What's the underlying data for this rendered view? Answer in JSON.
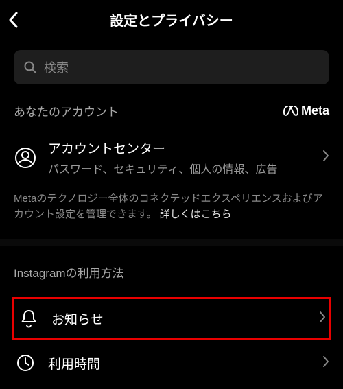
{
  "header": {
    "title": "設定とプライバシー"
  },
  "search": {
    "placeholder": "検索"
  },
  "account": {
    "section_label": "あなたのアカウント",
    "meta_label": "Meta",
    "center_title": "アカウントセンター",
    "center_sub": "パスワード、セキュリティ、個人の情報、広告",
    "note_prefix": "Metaのテクノロジー全体のコネクテッドエクスペリエンスおよびアカウント設定を管理できます。 ",
    "note_link": "詳しくはこちら"
  },
  "usage": {
    "section_label": "Instagramの利用方法",
    "notifications_label": "お知らせ",
    "time_label": "利用時間"
  }
}
